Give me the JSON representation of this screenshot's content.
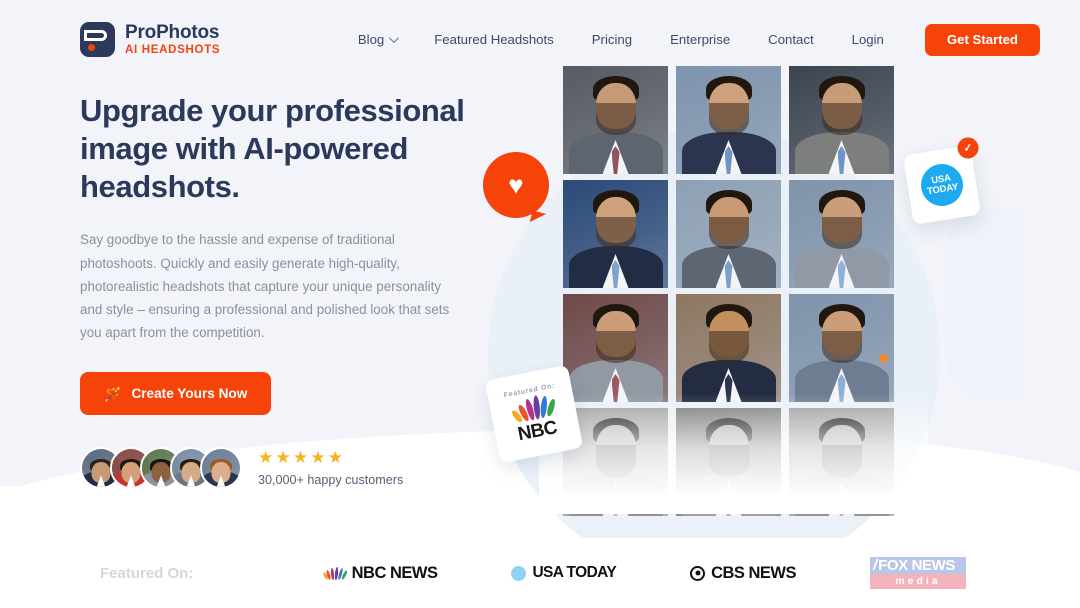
{
  "brand": {
    "name": "ProPhotos",
    "tagline": "AI HEADSHOTS",
    "logo_icon": "prophotos-logo-icon",
    "accent_color": "#f6430a",
    "navy_color": "#2b3a5b"
  },
  "nav": {
    "items": [
      {
        "label": "Blog",
        "has_dropdown": true
      },
      {
        "label": "Featured Headshots",
        "has_dropdown": false
      },
      {
        "label": "Pricing",
        "has_dropdown": false
      },
      {
        "label": "Enterprise",
        "has_dropdown": false
      },
      {
        "label": "Contact",
        "has_dropdown": false
      },
      {
        "label": "Login",
        "has_dropdown": false
      }
    ],
    "cta_label": "Get Started"
  },
  "hero": {
    "headline": "Upgrade your professional image with AI-powered headshots.",
    "subcopy": "Say goodbye to the hassle and expense of traditional photoshoots. Quickly and easily generate high-quality, photorealistic headshots that capture your unique personality and style – ensuring a professional and polished look that sets you apart from the competition.",
    "cta_label": "Create Yours Now",
    "cta_icon": "magic-wand-icon",
    "stars": "★★★★★",
    "star_color": "#f6b41f",
    "customers": "30,000+ happy customers",
    "avatar_count": 5
  },
  "badges": {
    "heart": {
      "icon": "heart-icon",
      "glyph": "♥",
      "color": "#f6430a"
    },
    "usa_today": {
      "line1": "USA",
      "line2": "TODAY",
      "check_glyph": "✓",
      "circle_color": "#1eaaf1"
    },
    "nbc": {
      "caption": "Featured On:",
      "word": "NBC"
    }
  },
  "gallery": {
    "rows": 4,
    "columns": 3,
    "photos": [
      {
        "bg": "#565b63",
        "suit": "#5d6571",
        "tie": "#8d5560",
        "skin": "#c79a76",
        "gray": false
      },
      {
        "bg": "#7e93ad",
        "suit": "#2b3550",
        "tie": "#6f93c4",
        "skin": "#cfa07c",
        "gray": false
      },
      {
        "bg": "#3c4450",
        "suit": "#7d7f7c",
        "tie": "#6f93c4",
        "skin": "#c99c78",
        "gray": false
      },
      {
        "bg": "#2b4a78",
        "suit": "#222c44",
        "tie": "#7ea3cf",
        "skin": "#cfa27e",
        "gray": false
      },
      {
        "bg": "#8ea0b4",
        "suit": "#5e6673",
        "tie": "#7ba0cb",
        "skin": "#c99a74",
        "gray": false
      },
      {
        "bg": "#7f93ab",
        "suit": "#9099a5",
        "tie": "#8fb0d6",
        "skin": "#cb9d79",
        "gray": false
      },
      {
        "bg": "#6e4a49",
        "suit": "#9299a3",
        "tie": "#9b5a62",
        "skin": "#cb9d79",
        "gray": false
      },
      {
        "bg": "#8d7762",
        "suit": "#232c42",
        "tie": "#2a3350",
        "skin": "#c2905f",
        "gray": false
      },
      {
        "bg": "#7f93ab",
        "suit": "#6f7d92",
        "tie": "#8fb0d6",
        "skin": "#cb9d79",
        "gray": false
      },
      {
        "bg": "#9aa0a6",
        "suit": "#8d929a",
        "tie": "#b9bdc3",
        "skin": "#b6b6b6",
        "gray": true
      },
      {
        "bg": "#82786e",
        "suit": "#9ba0a6",
        "tie": "#aeb3b9",
        "skin": "#b3b3b3",
        "gray": true
      },
      {
        "bg": "#98a0a8",
        "suit": "#8f949b",
        "tie": "#b4b8be",
        "skin": "#b5b5b5",
        "gray": true
      }
    ]
  },
  "featured_bar": {
    "label": "Featured On:",
    "brands": [
      {
        "name": "NBC NEWS",
        "icon": "nbc-peacock-icon"
      },
      {
        "name": "USA TODAY",
        "icon": "usa-today-dot-icon"
      },
      {
        "name": "CBS NEWS",
        "icon": "cbs-eye-icon"
      },
      {
        "name": "FOX NEWS",
        "sub": "media",
        "icon": "fox-news-icon"
      }
    ]
  },
  "peacock_colors": [
    "#f5a623",
    "#e8542d",
    "#b5318a",
    "#6b3fa0",
    "#2e7fd4",
    "#3aa646"
  ]
}
